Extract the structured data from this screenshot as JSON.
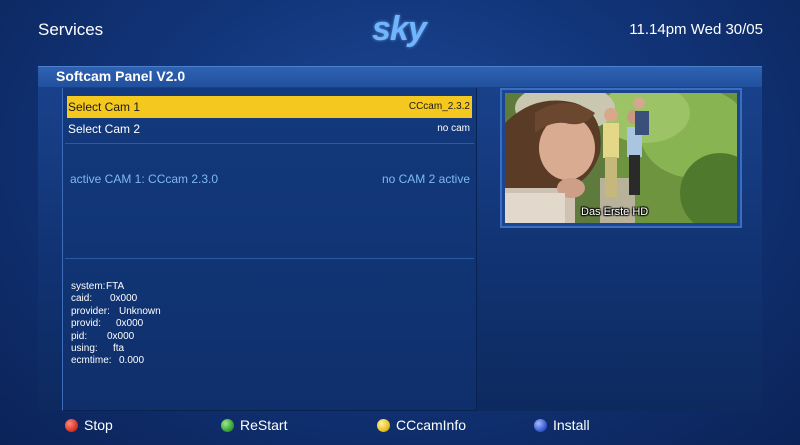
{
  "header": {
    "title": "Services",
    "logo_text": "sky",
    "clock": "11.14pm Wed 30/05"
  },
  "panel": {
    "title": "Softcam Panel V2.0",
    "rows": [
      {
        "label": "Select Cam 1",
        "value": "CCcam_2.3.2"
      },
      {
        "label": "Select Cam 2",
        "value": "no cam"
      }
    ],
    "active_cam1": "active CAM 1: CCcam 2.3.0",
    "active_cam2": "no CAM 2 active",
    "info": [
      {
        "key": "system:",
        "value": "FTA"
      },
      {
        "key": "caid:",
        "value": "0x000"
      },
      {
        "key": "provider:",
        "value": "Unknown"
      },
      {
        "key": "provid:",
        "value": "0x000"
      },
      {
        "key": "pid:",
        "value": "0x000"
      },
      {
        "key": "using:",
        "value": "fta"
      },
      {
        "key": "ecmtime:",
        "value": "0.000"
      }
    ],
    "preview_channel": "Das Erste HD"
  },
  "footer": {
    "buttons": [
      {
        "label": "Stop",
        "color": "#d93a2b",
        "icon": "red-button-icon"
      },
      {
        "label": "ReStart",
        "color": "#3aa33a",
        "icon": "green-button-icon"
      },
      {
        "label": "CCcamInfo",
        "color": "#e8c12a",
        "icon": "yellow-button-icon"
      },
      {
        "label": "Install",
        "color": "#3b5fd6",
        "icon": "blue-button-icon"
      }
    ]
  },
  "colors": {
    "selection": "#f4c81e",
    "active_text": "#7fb8f0",
    "logo": "#6fb6ff"
  }
}
